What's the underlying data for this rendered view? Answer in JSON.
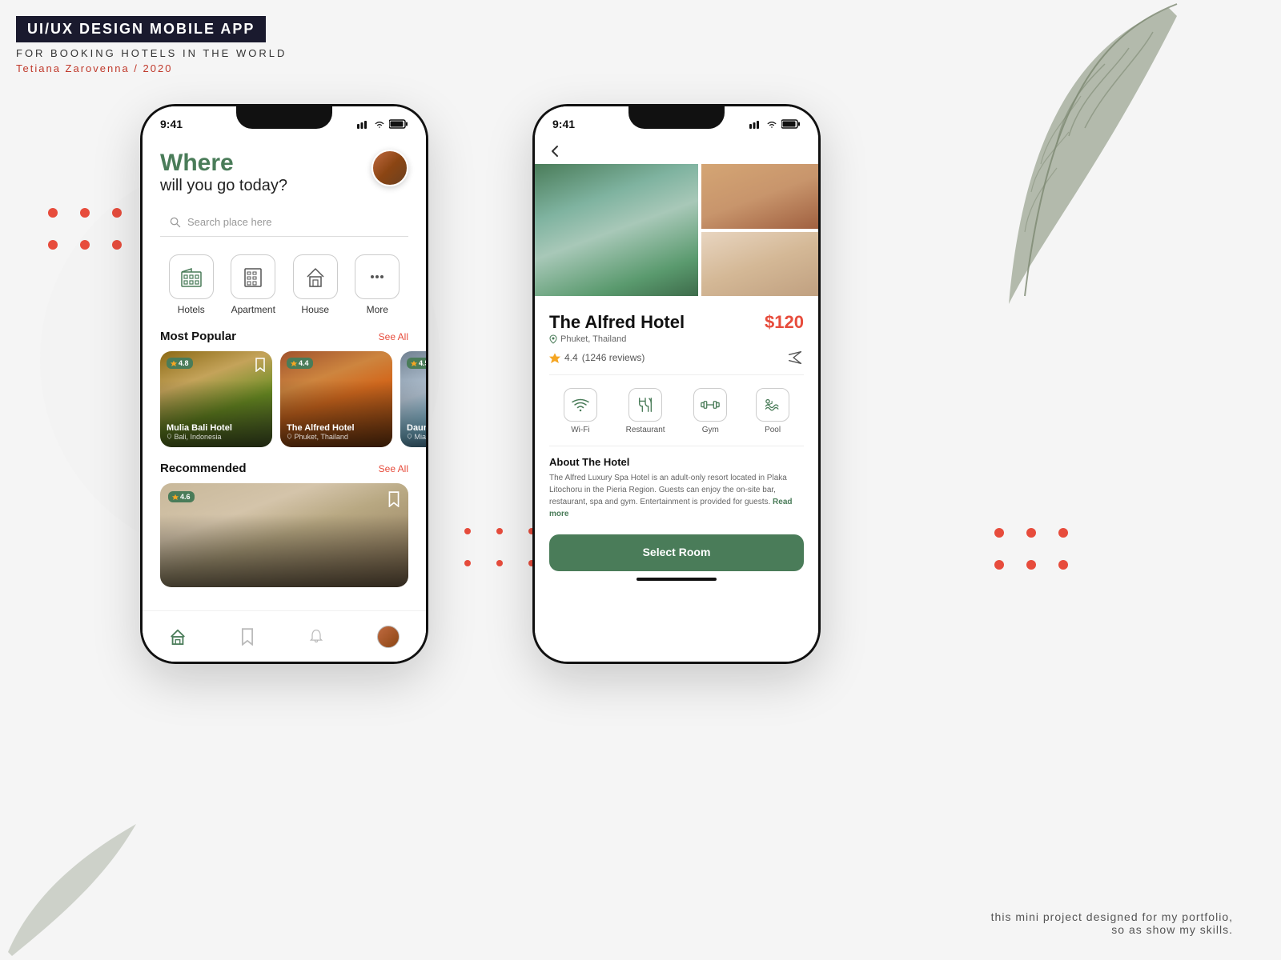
{
  "header": {
    "title": "UI/UX DESIGN MOBILE APP",
    "subtitle": "FOR BOOKING HOTELS IN THE WORLD",
    "author": "Tetiana Zarovenna / 2020"
  },
  "footer": {
    "line1": "this mini project designed for my portfolio,",
    "line2": "so as show my skills."
  },
  "phone1": {
    "status_time": "9:41",
    "greeting_where": "Where",
    "greeting_sub": "will you go today?",
    "search_placeholder": "Search place here",
    "categories": [
      {
        "label": "Hotels"
      },
      {
        "label": "Apartment"
      },
      {
        "label": "House"
      },
      {
        "label": "More"
      }
    ],
    "most_popular_title": "Most Popular",
    "see_all": "See All",
    "hotels": [
      {
        "name": "Mulia Bali Hotel",
        "location": "Bali, Indonesia",
        "rating": "4.8"
      },
      {
        "name": "The Alfred Hotel",
        "location": "Phuket, Thailand",
        "rating": "4.4"
      },
      {
        "name": "Daun Lek",
        "location": "Miami Be",
        "rating": "4.5"
      }
    ],
    "recommended_title": "Recommended",
    "see_all2": "See All",
    "rec_hotel": {
      "rating": "4.6"
    },
    "nav_items": [
      "home",
      "bookmark",
      "notification",
      "profile"
    ]
  },
  "phone2": {
    "status_time": "9:41",
    "back_icon": "‹",
    "hotel_name": "The Alfred Hotel",
    "price": "$120",
    "location": "Phuket, Thailand",
    "rating": "4.4",
    "reviews": "(1246 reviews)",
    "amenities": [
      {
        "label": "Wi-Fi"
      },
      {
        "label": "Restaurant"
      },
      {
        "label": "Gym"
      },
      {
        "label": "Pool"
      }
    ],
    "about_title": "About The Hotel",
    "about_text": "The Alfred Luxury Spa Hotel is an adult-only resort located in Plaka Litochoru in the Pieria Region. Guests can enjoy the on-site bar, restaurant, spa and gym. Entertainment is provided for guests.",
    "read_more": "Read more",
    "select_room": "Select Room"
  }
}
